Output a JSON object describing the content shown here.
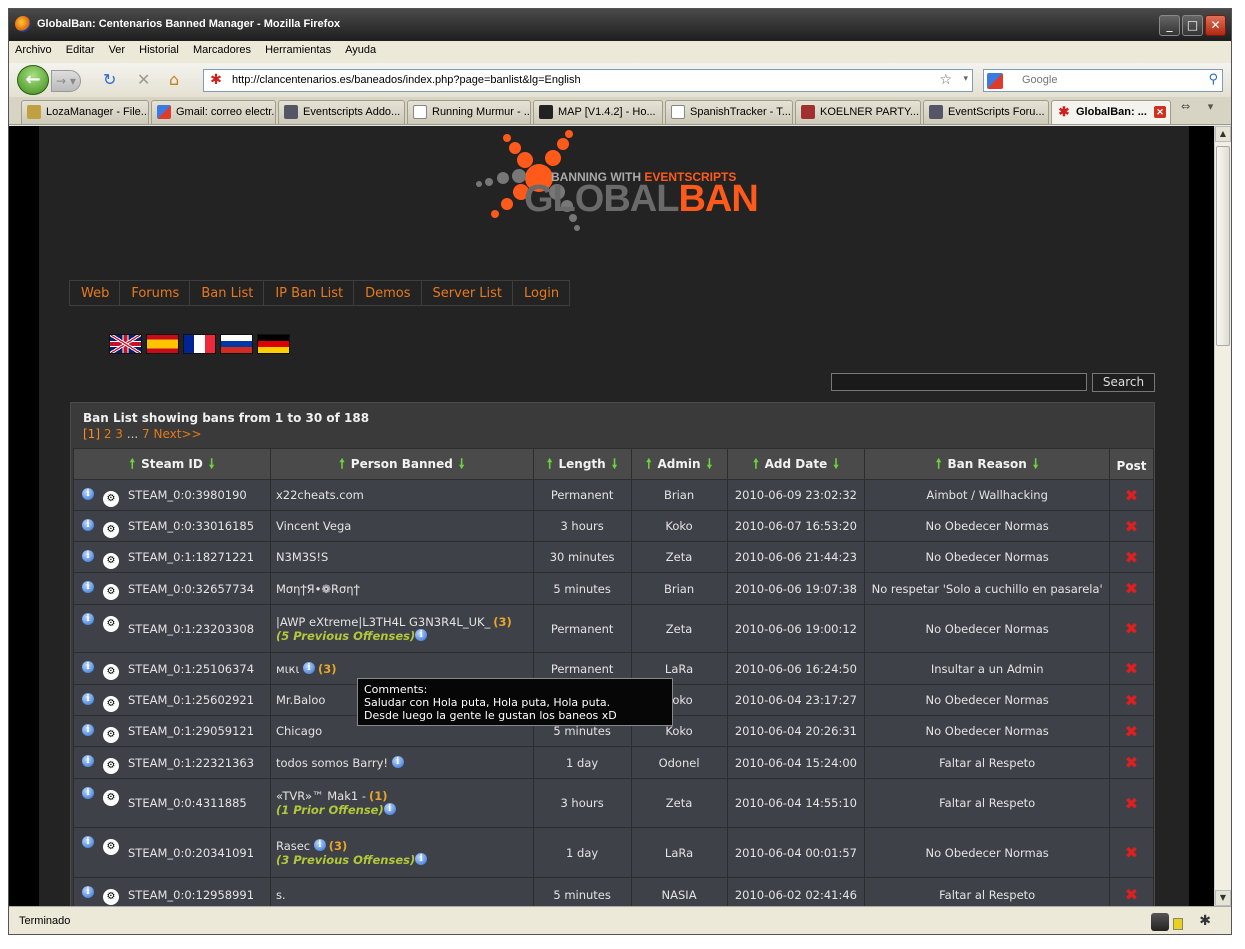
{
  "window": {
    "title": "GlobalBan: Centenarios Banned Manager - Mozilla Firefox"
  },
  "menu": [
    "Archivo",
    "Editar",
    "Ver",
    "Historial",
    "Marcadores",
    "Herramientas",
    "Ayuda"
  ],
  "navbar": {
    "url": "http://clancentenarios.es/baneados/index.php?page=banlist&lg=English",
    "search_placeholder": "Google"
  },
  "tabs": [
    {
      "label": "LozaManager - File..."
    },
    {
      "label": "Gmail: correo electr..."
    },
    {
      "label": "Eventscripts Addo..."
    },
    {
      "label": "Running Murmur - ..."
    },
    {
      "label": "MAP [V1.4.2] - Ho..."
    },
    {
      "label": "SpanishTracker - T..."
    },
    {
      "label": "KOELNER PARTY..."
    },
    {
      "label": "EventScripts Foru..."
    },
    {
      "label": "GlobalBan: ..."
    }
  ],
  "logo": {
    "tagline_1": "BANNING WITH ",
    "tagline_2": "EVENTSCRIPTS",
    "word_1": "GLOBAL",
    "word_2": "BAN"
  },
  "site_nav": [
    "Web",
    "Forums",
    "Ban List",
    "IP Ban List",
    "Demos",
    "Server List",
    "Login"
  ],
  "search": {
    "button": "Search"
  },
  "banlist": {
    "title": "Ban List showing bans from 1 to 30 of 188",
    "pager": {
      "current": "[1]",
      "p2": "2",
      "p3": "3",
      "dots": "...",
      "p7": "7",
      "next": "Next>>"
    },
    "headers": {
      "steam": "Steam ID",
      "person": "Person Banned",
      "length": "Length",
      "admin": "Admin",
      "date": "Add Date",
      "reason": "Ban Reason",
      "post": "Post"
    },
    "rows": [
      {
        "steam": "STEAM_0:0:3980190",
        "name": "x22cheats.com",
        "count": "",
        "offenses": "",
        "length": "Permanent",
        "admin": "Brian",
        "date": "2010-06-09 23:02:32",
        "reason": "Aimbot /  Wallhacking"
      },
      {
        "steam": "STEAM_0:0:33016185",
        "name": "Vincent Vega",
        "count": "",
        "offenses": "",
        "length": "3 hours",
        "admin": "Koko",
        "date": "2010-06-07 16:53:20",
        "reason": "No Obedecer Normas"
      },
      {
        "steam": "STEAM_0:1:18271221",
        "name": "N3M3S!S",
        "count": "",
        "offenses": "",
        "length": "30 minutes",
        "admin": "Zeta",
        "date": "2010-06-06 21:44:23",
        "reason": "No Obedecer Normas"
      },
      {
        "steam": "STEAM_0:0:32657734",
        "name": "MσηϯЯ•❁Rσηϯ",
        "count": "",
        "offenses": "",
        "length": "5 minutes",
        "admin": "Brian",
        "date": "2010-06-06 19:07:38",
        "reason": "No respetar 'Solo a cuchillo en pasarela'"
      },
      {
        "steam": "STEAM_0:1:23203308",
        "name": "|AWP eXtreme|L3TH4L G3N3R4L_UK_",
        "count": "(3)",
        "offenses": "(5 Previous Offenses)",
        "length": "Permanent",
        "admin": "Zeta",
        "date": "2010-06-06 19:00:12",
        "reason": "No Obedecer Normas"
      },
      {
        "steam": "STEAM_0:1:25106374",
        "name": "мιкι",
        "count": "(3)",
        "offenses": "",
        "length": "Permanent",
        "admin": "LaRa",
        "date": "2010-06-06 16:24:50",
        "reason": "Insultar a un Admin"
      },
      {
        "steam": "STEAM_0:1:25602921",
        "name": "Mr.Baloo",
        "count": "",
        "offenses": "",
        "length": "",
        "admin": "Koko",
        "date": "2010-06-04 23:17:27",
        "reason": "No Obedecer Normas"
      },
      {
        "steam": "STEAM_0:1:29059121",
        "name": "Chicago",
        "count": "",
        "offenses": "",
        "length": "5 minutes",
        "admin": "Koko",
        "date": "2010-06-04 20:26:31",
        "reason": "No Obedecer Normas"
      },
      {
        "steam": "STEAM_0:1:22321363",
        "name": "todos somos Barry!",
        "count": "",
        "offenses": "",
        "length": "1 day",
        "admin": "Odonel",
        "date": "2010-06-04 15:24:00",
        "reason": "Faltar al Respeto"
      },
      {
        "steam": "STEAM_0:0:4311885",
        "name": "«TVR»™ Mak1 -",
        "count": "(1)",
        "offenses": "(1 Prior Offense)",
        "length": "3 hours",
        "admin": "Zeta",
        "date": "2010-06-04 14:55:10",
        "reason": "Faltar al Respeto"
      },
      {
        "steam": "STEAM_0:0:20341091",
        "name": "Rasec",
        "count": "(3)",
        "offenses": "(3 Previous Offenses)",
        "length": "1 day",
        "admin": "LaRa",
        "date": "2010-06-04 00:01:57",
        "reason": "No Obedecer Normas"
      },
      {
        "steam": "STEAM_0:0:12958991",
        "name": "s.",
        "count": "",
        "offenses": "",
        "length": "5 minutes",
        "admin": "NASIA",
        "date": "2010-06-02 02:41:46",
        "reason": "Faltar al Respeto"
      }
    ]
  },
  "tooltip": {
    "heading": "Comments:",
    "line1": "Saludar con Hola puta, Hola puta, Hola puta.",
    "line2": "Desde luego la gente le gustan los baneos xD"
  },
  "status": {
    "text": "Terminado"
  },
  "colors": {
    "accent": "#e87a1c",
    "page_bg": "#232323",
    "row_bg": "#3e4147",
    "delete": "#e02020"
  }
}
